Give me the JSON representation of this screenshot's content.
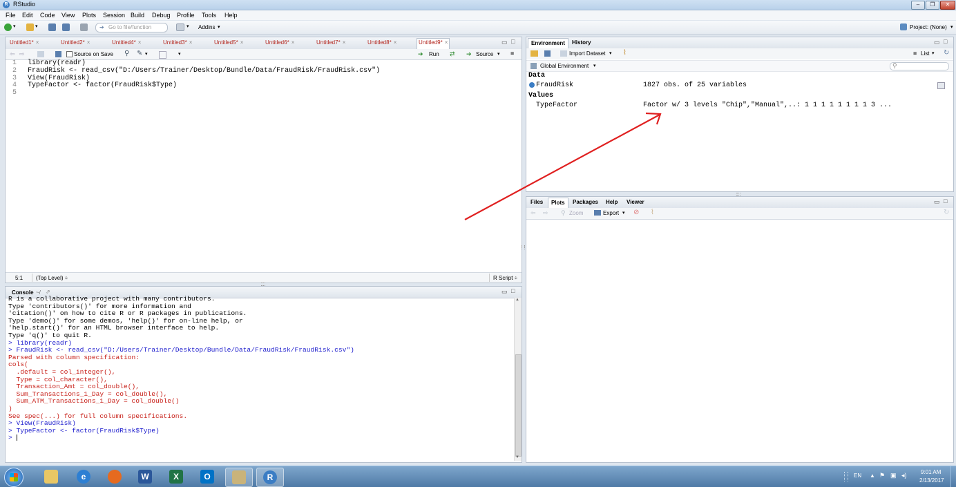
{
  "window": {
    "title": "RStudio"
  },
  "menu": [
    "File",
    "Edit",
    "Code",
    "View",
    "Plots",
    "Session",
    "Build",
    "Debug",
    "Profile",
    "Tools",
    "Help"
  ],
  "toolbar": {
    "goto_placeholder": "Go to file/function",
    "addins": "Addins",
    "project": "Project: (None)"
  },
  "editor": {
    "tabs": [
      "Untitled1*",
      "Untitled2*",
      "Untitled4*",
      "Untitled3*",
      "Untitled5*",
      "Untitled6*",
      "Untitled7*",
      "Untitled8*",
      "Untitled9*"
    ],
    "active_tab": "Untitled9*",
    "source_on_save": "Source on Save",
    "run": "Run",
    "source": "Source",
    "lines": [
      {
        "n": "1",
        "text": "library(readr)"
      },
      {
        "n": "2",
        "text": "FraudRisk <- read_csv(\"D:/Users/Trainer/Desktop/Bundle/Data/FraudRisk/FraudRisk.csv\")"
      },
      {
        "n": "3",
        "text": "View(FraudRisk)"
      },
      {
        "n": "4",
        "text": "TypeFactor <- factor(FraudRisk$Type)"
      },
      {
        "n": "5",
        "text": ""
      }
    ],
    "status_pos": "5:1",
    "status_scope": "(Top Level) ÷",
    "status_type": "R Script ÷"
  },
  "console": {
    "title": "Console",
    "path": "~/",
    "lines": [
      {
        "cls": "black",
        "text": "R is a collaborative project with many contributors."
      },
      {
        "cls": "black",
        "text": "Type 'contributors()' for more information and"
      },
      {
        "cls": "black",
        "text": "'citation()' on how to cite R or R packages in publications."
      },
      {
        "cls": "black",
        "text": ""
      },
      {
        "cls": "black",
        "text": "Type 'demo()' for some demos, 'help()' for on-line help, or"
      },
      {
        "cls": "black",
        "text": "'help.start()' for an HTML browser interface to help."
      },
      {
        "cls": "black",
        "text": "Type 'q()' to quit R."
      },
      {
        "cls": "black",
        "text": ""
      },
      {
        "cls": "blue",
        "text": "> library(readr)"
      },
      {
        "cls": "blue",
        "text": "> FraudRisk <- read_csv(\"D:/Users/Trainer/Desktop/Bundle/Data/FraudRisk/FraudRisk.csv\")"
      },
      {
        "cls": "red",
        "text": "Parsed with column specification:"
      },
      {
        "cls": "red",
        "text": "cols("
      },
      {
        "cls": "red",
        "text": "  .default = col_integer(),"
      },
      {
        "cls": "red",
        "text": "  Type = col_character(),"
      },
      {
        "cls": "red",
        "text": "  Transaction_Amt = col_double(),"
      },
      {
        "cls": "red",
        "text": "  Sum_Transactions_1_Day = col_double(),"
      },
      {
        "cls": "red",
        "text": "  Sum_ATM_Transactions_1_Day = col_double()"
      },
      {
        "cls": "red",
        "text": ")"
      },
      {
        "cls": "red",
        "text": "See spec(...) for full column specifications."
      },
      {
        "cls": "blue",
        "text": "> View(FraudRisk)"
      },
      {
        "cls": "blue",
        "text": "> TypeFactor <- factor(FraudRisk$Type)"
      },
      {
        "cls": "blue",
        "text": "> "
      }
    ]
  },
  "environment": {
    "tabs": [
      "Environment",
      "History"
    ],
    "import_dataset": "Import Dataset",
    "list": "List",
    "global_env": "Global Environment",
    "section_data": "Data",
    "data_rows": [
      {
        "name": "FraudRisk",
        "value": "1827 obs. of 25 variables"
      }
    ],
    "section_values": "Values",
    "value_rows": [
      {
        "name": "TypeFactor",
        "value": "Factor w/ 3 levels \"Chip\",\"Manual\",..: 1 1 1 1 1 1 1 1 3 ..."
      }
    ]
  },
  "files_pane": {
    "tabs": [
      "Files",
      "Plots",
      "Packages",
      "Help",
      "Viewer"
    ],
    "active_tab": "Plots",
    "zoom": "Zoom",
    "export": "Export"
  },
  "taskbar": {
    "lang": "EN",
    "time": "9:01 AM",
    "date": "2/13/2017"
  },
  "colors": {
    "annotation_arrow": "#e02020",
    "accent": "#3b7dc4"
  }
}
